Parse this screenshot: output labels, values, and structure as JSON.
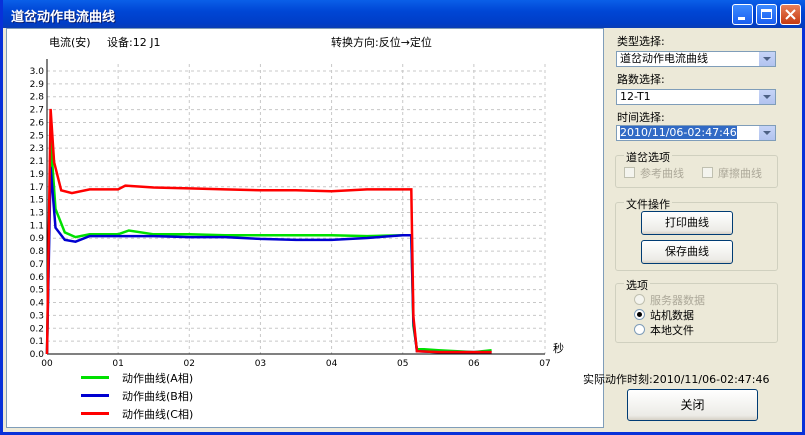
{
  "window": {
    "title": "道岔动作电流曲线"
  },
  "chart": {
    "ylabel": "电流(安)",
    "device_label": "设备:12 J1",
    "direction_label": "转换方向:反位→定位",
    "xunit": "秒",
    "legend": [
      "动作曲线(A相)",
      "动作曲线(B相)",
      "动作曲线(C相)"
    ]
  },
  "chart_data": {
    "type": "line",
    "xlim": [
      0,
      7
    ],
    "ylim": [
      0,
      3.1
    ],
    "xticks": [
      "00",
      "01",
      "02",
      "03",
      "04",
      "05",
      "06",
      "07"
    ],
    "yticks": [
      "0.0",
      "0.1",
      "0.2",
      "0.3",
      "0.4",
      "0.5",
      "0.6",
      "0.7",
      "0.8",
      "0.9",
      "1.1",
      "1.3",
      "1.5",
      "1.7",
      "1.9",
      "2.1",
      "2.3",
      "2.5",
      "2.6",
      "2.7",
      "2.8",
      "2.9",
      "3.0"
    ],
    "series": [
      {
        "name": "动作曲线(A相)",
        "color": "#00e000",
        "x": [
          0.0,
          0.05,
          0.12,
          0.25,
          0.4,
          0.6,
          1.0,
          1.15,
          1.5,
          2.0,
          2.5,
          3.0,
          3.5,
          4.0,
          4.5,
          5.0,
          5.12,
          5.15,
          5.2,
          5.3,
          5.5,
          6.0,
          6.25
        ],
        "y": [
          0.0,
          2.3,
          1.55,
          1.3,
          1.25,
          1.28,
          1.28,
          1.32,
          1.28,
          1.28,
          1.27,
          1.27,
          1.27,
          1.27,
          1.26,
          1.27,
          1.27,
          0.3,
          0.05,
          0.05,
          0.04,
          0.02,
          0.04
        ]
      },
      {
        "name": "动作曲线(B相)",
        "color": "#0000d0",
        "x": [
          0.0,
          0.05,
          0.12,
          0.25,
          0.4,
          0.6,
          1.0,
          1.5,
          2.0,
          2.5,
          3.0,
          3.5,
          4.0,
          4.5,
          5.0,
          5.12,
          5.15,
          5.2,
          5.5,
          6.0,
          6.25
        ],
        "y": [
          0.0,
          2.0,
          1.35,
          1.22,
          1.2,
          1.26,
          1.26,
          1.26,
          1.25,
          1.25,
          1.23,
          1.22,
          1.22,
          1.24,
          1.27,
          1.27,
          0.35,
          0.03,
          0.02,
          0.02,
          0.02
        ]
      },
      {
        "name": "动作曲线(C相)",
        "color": "#ff0000",
        "x": [
          0.0,
          0.05,
          0.1,
          0.2,
          0.35,
          0.6,
          1.0,
          1.1,
          1.5,
          2.0,
          2.5,
          3.0,
          3.5,
          4.0,
          4.5,
          5.0,
          5.12,
          5.15,
          5.2,
          5.5,
          6.0,
          6.25
        ],
        "y": [
          0.0,
          2.62,
          2.05,
          1.75,
          1.72,
          1.76,
          1.76,
          1.8,
          1.78,
          1.77,
          1.76,
          1.75,
          1.75,
          1.74,
          1.76,
          1.76,
          1.76,
          0.4,
          0.03,
          0.02,
          0.02,
          0.02
        ]
      }
    ]
  },
  "panel": {
    "type_label": "类型选择:",
    "type_value": "道岔动作电流曲线",
    "route_label": "路数选择:",
    "route_value": "12-T1",
    "time_label": "时间选择:",
    "time_value": "2010/11/06-02:47:46",
    "switch_group": "道岔选项",
    "ref_curve": "参考曲线",
    "friction_curve": "摩擦曲线",
    "file_group": "文件操作",
    "print_btn": "打印曲线",
    "save_btn": "保存曲线",
    "options_group": "选项",
    "opt_server": "服务器数据",
    "opt_station": "站机数据",
    "opt_local": "本地文件",
    "actual_time": "实际动作时刻:2010/11/06-02:47:46",
    "close_btn": "关闭"
  }
}
